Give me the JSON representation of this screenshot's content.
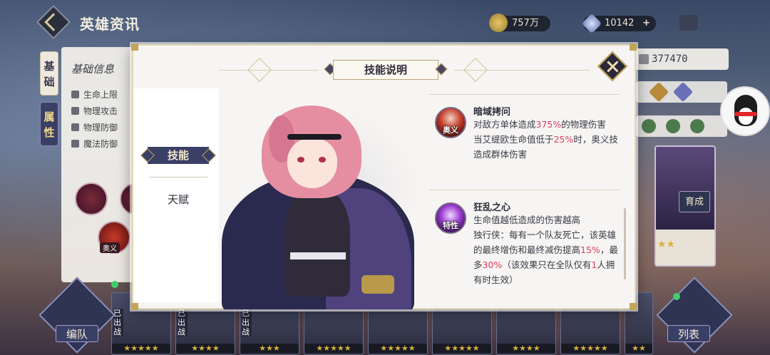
{
  "header": {
    "title": "英雄资讯",
    "gold": "757万",
    "gems": "10142",
    "gems_plus": "+"
  },
  "background": {
    "side_tabs": [
      "基础",
      "属性"
    ],
    "basic_info_title": "基础信息",
    "stats": [
      "生命上限",
      "物理攻击",
      "物理防御",
      "魔法防御"
    ],
    "bubble_tag": "奥义",
    "power": "377470",
    "upgrade_label": "育成",
    "card_stars": "★★",
    "team_button": "编队",
    "list_button": "列表",
    "deployed_label": "已出战",
    "roster_stars": [
      "★★★★★",
      "★★★★",
      "★★★",
      "★★★★★",
      "★★★★★",
      "★★★★★",
      "★★★★",
      "★★★★★",
      "★★"
    ]
  },
  "modal": {
    "title": "技能说明",
    "tabs": {
      "skill": "技能",
      "talent": "天赋"
    },
    "skills": [
      {
        "icon": "ultimate-skill-icon",
        "tag": "奥义",
        "name": "暗域拷问",
        "desc_parts": [
          {
            "t": "对敌方单体造成",
            "h": false
          },
          {
            "t": "375%",
            "h": true
          },
          {
            "t": "的物理伤害",
            "h": false
          },
          {
            "t": "当艾缇欧生命值低于",
            "h": false
          },
          {
            "t": "25%",
            "h": true
          },
          {
            "t": "时，奥义技造成群体伤害",
            "h": false
          }
        ]
      },
      {
        "icon": "trait-skill-icon",
        "tag": "特性",
        "name": "狂乱之心",
        "desc_parts": [
          {
            "t": "生命值越低造成的伤害越高",
            "h": false
          },
          {
            "t": "独行侠：每有一个队友死亡，该英雄的最终增伤和最终减伤提高",
            "h": false
          },
          {
            "t": "15%",
            "h": true
          },
          {
            "t": "，最多",
            "h": false
          },
          {
            "t": "30%",
            "h": true
          },
          {
            "t": "（该效果只在全队仅有",
            "h": false
          },
          {
            "t": "1",
            "h": true
          },
          {
            "t": "人拥有时生效）",
            "h": false
          }
        ]
      }
    ]
  },
  "colors": {
    "highlight": "#e0405a",
    "tab_active": "#3a3f66",
    "gold_trim": "#c4a45a"
  }
}
